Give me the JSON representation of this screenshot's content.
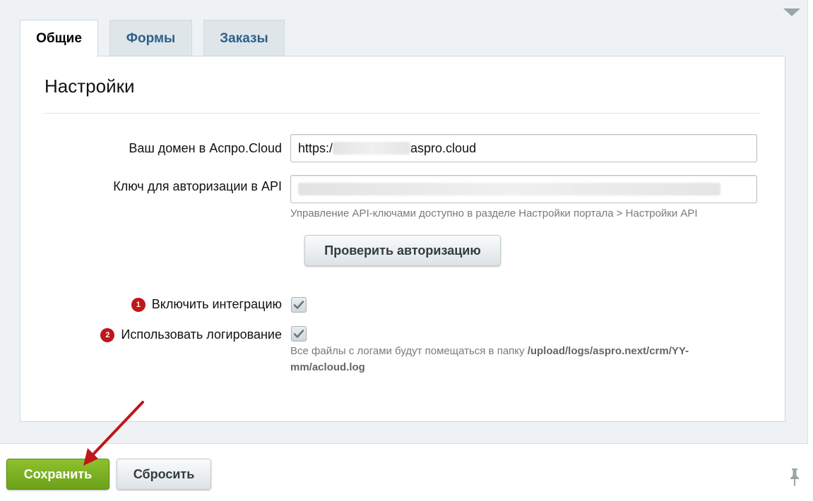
{
  "tabs": [
    {
      "label": "Общие",
      "active": true
    },
    {
      "label": "Формы",
      "active": false
    },
    {
      "label": "Заказы",
      "active": false
    }
  ],
  "panel": {
    "title": "Настройки",
    "domain": {
      "label": "Ваш домен в Аспро.Cloud",
      "value_prefix": "https:/",
      "value_suffix": "aspro.cloud"
    },
    "api_key": {
      "label": "Ключ для авторизации в API",
      "hint": "Управление API-ключами доступно в разделе Настройки портала > Настройки API"
    },
    "check_button": "Проверить авторизацию",
    "enable_integration": {
      "badge": "1",
      "label": "Включить интеграцию",
      "checked": true
    },
    "use_logging": {
      "badge": "2",
      "label": "Использовать логирование",
      "checked": true,
      "hint_prefix": "Все файлы с логами будут помещаться в папку ",
      "hint_path": "/upload/logs/aspro.next/crm/YY-mm/acloud.log"
    }
  },
  "footer": {
    "save_label": "Сохранить",
    "reset_label": "Сбросить"
  },
  "colors": {
    "tab_text": "#2e5e8c",
    "badge": "#c0161a",
    "save_button": "#7cb21f",
    "annotation_arrow": "#c0161a"
  }
}
